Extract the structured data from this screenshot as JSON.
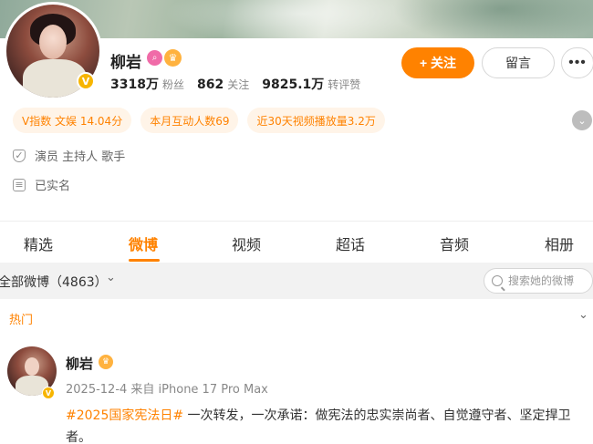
{
  "profile": {
    "name": "柳岩",
    "verified_badge": "V",
    "icons": [
      "search-badge-icon",
      "crown-icon"
    ],
    "stats": [
      {
        "num": "3318万",
        "label": "粉丝"
      },
      {
        "num": "862",
        "label": "关注"
      },
      {
        "num": "9825.1万",
        "label": "转评赞"
      }
    ],
    "follow_label": "+ 关注",
    "message_label": "留言",
    "more_label": "•••"
  },
  "tags": [
    "V指数 文娱 14.04分",
    "本月互动人数69",
    "近30天视频播放量3.2万"
  ],
  "info": {
    "occupation": "演员 主持人 歌手",
    "realname": "已实名"
  },
  "tabs": [
    "精选",
    "微博",
    "视频",
    "超话",
    "音频",
    "相册"
  ],
  "active_tab": "微博",
  "filter": {
    "label": "全部微博（4863）",
    "search_placeholder": "搜索她的微博"
  },
  "section": {
    "hot_label": "热门"
  },
  "post": {
    "author": "柳岩",
    "meta": "2025-12-4  来自 iPhone 17 Pro Max",
    "topic": "#2025国家宪法日#",
    "text": " 一次转发，一次承诺：做宪法的忠实崇尚者、自觉遵守者、坚定捍卫者。"
  },
  "colors": {
    "accent": "#ff8200",
    "verified": "#f7b500",
    "tag_bg": "#fff4e8"
  }
}
